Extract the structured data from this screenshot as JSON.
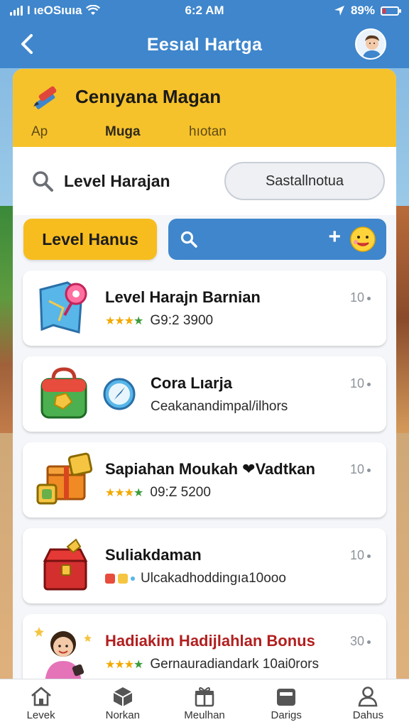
{
  "status_bar": {
    "carrier": "I ιeOSıuıa",
    "time": "6:2 AM",
    "battery": "89%",
    "battery_level": 0.2
  },
  "header": {
    "title": "Eesıal Hartga"
  },
  "card": {
    "title": "Cenıyana  Magan",
    "tabs": [
      "Ap",
      "Muga",
      "hıotan"
    ]
  },
  "search": {
    "label": "Level Harajan",
    "button_label": "Sastallnotua"
  },
  "actions": {
    "level_button": "Level Hanus"
  },
  "items": [
    {
      "title": "Level Harajn Barnian",
      "sub": "G9:2 3900",
      "count": "10",
      "icon": "map-pin-icon",
      "has_stars": true
    },
    {
      "title": "Cora Lıarja",
      "sub": "Ceakanandimpal/ilhors",
      "count": "10",
      "icon": "compass-icon",
      "has_stars": false
    },
    {
      "title": "Sapiahan Moukah ❤Vadtkan",
      "sub": "09:Z 5200",
      "count": "10",
      "icon": "gift-boxes-icon",
      "has_stars": true
    },
    {
      "title": "Suliakdaman",
      "sub": "Ulcakadhoddingıa10ooo",
      "count": "10",
      "icon": "treasure-chest-icon",
      "has_stars": false
    },
    {
      "title": "Hadiakim Hadijlahlan Bonus",
      "sub": "Gernauradiandark 10ai0rors",
      "count": "30",
      "icon": "character-icon",
      "has_stars": true
    }
  ],
  "nav": [
    {
      "label": "Levek",
      "icon": "home-icon"
    },
    {
      "label": "Norkan",
      "icon": "box-icon"
    },
    {
      "label": "Meulhan",
      "icon": "gift-icon"
    },
    {
      "label": "Darigs",
      "icon": "wallet-icon"
    },
    {
      "label": "Dahus",
      "icon": "user-icon"
    }
  ],
  "colors": {
    "primary_blue": "#3f86cc",
    "accent_yellow": "#f6c22b",
    "title_red": "#b21f1f"
  }
}
